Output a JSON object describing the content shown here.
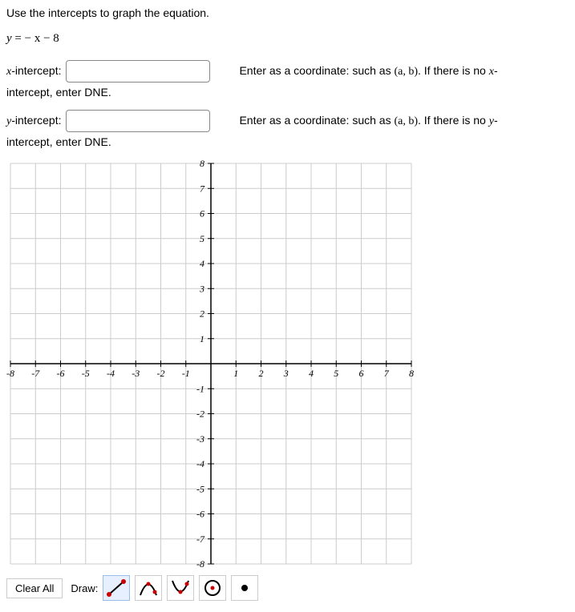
{
  "prompt": "Use the intercepts to graph the equation.",
  "equation": {
    "prefix": "y",
    "rest": " =  − x − 8"
  },
  "x_intercept": {
    "label_var": "x",
    "label_suffix": "-intercept:",
    "value": "",
    "hint_prefix": "Enter as a coordinate: such as ",
    "hint_coord": "(a, b)",
    "hint_mid": ". If there is no ",
    "hint_var": "x",
    "hint_end": "-",
    "subtext": "intercept, enter DNE."
  },
  "y_intercept": {
    "label_var": "y",
    "label_suffix": "-intercept:",
    "value": "",
    "hint_prefix": "Enter as a coordinate: such as ",
    "hint_coord": "(a, b)",
    "hint_mid": ". If there is no ",
    "hint_var": "y",
    "hint_end": "-",
    "subtext": "intercept, enter DNE."
  },
  "graph": {
    "x_ticks": [
      "-8",
      "-7",
      "-6",
      "-5",
      "-4",
      "-3",
      "-2",
      "-1",
      "1",
      "2",
      "3",
      "4",
      "5",
      "6",
      "7",
      "8"
    ],
    "y_ticks": [
      "8",
      "7",
      "6",
      "5",
      "4",
      "3",
      "2",
      "1",
      "-1",
      "-2",
      "-3",
      "-4",
      "-5",
      "-6",
      "-7",
      "-8"
    ],
    "xmin": -8,
    "xmax": 8,
    "ymin": -8,
    "ymax": 8
  },
  "toolbar": {
    "clear_label": "Clear All",
    "draw_label": "Draw:",
    "tools": {
      "line": "line-tool-icon",
      "curve_up": "curve-up-tool-icon",
      "curve_down": "curve-down-tool-icon",
      "circle": "circle-tool-icon",
      "point": "point-tool-icon"
    }
  }
}
